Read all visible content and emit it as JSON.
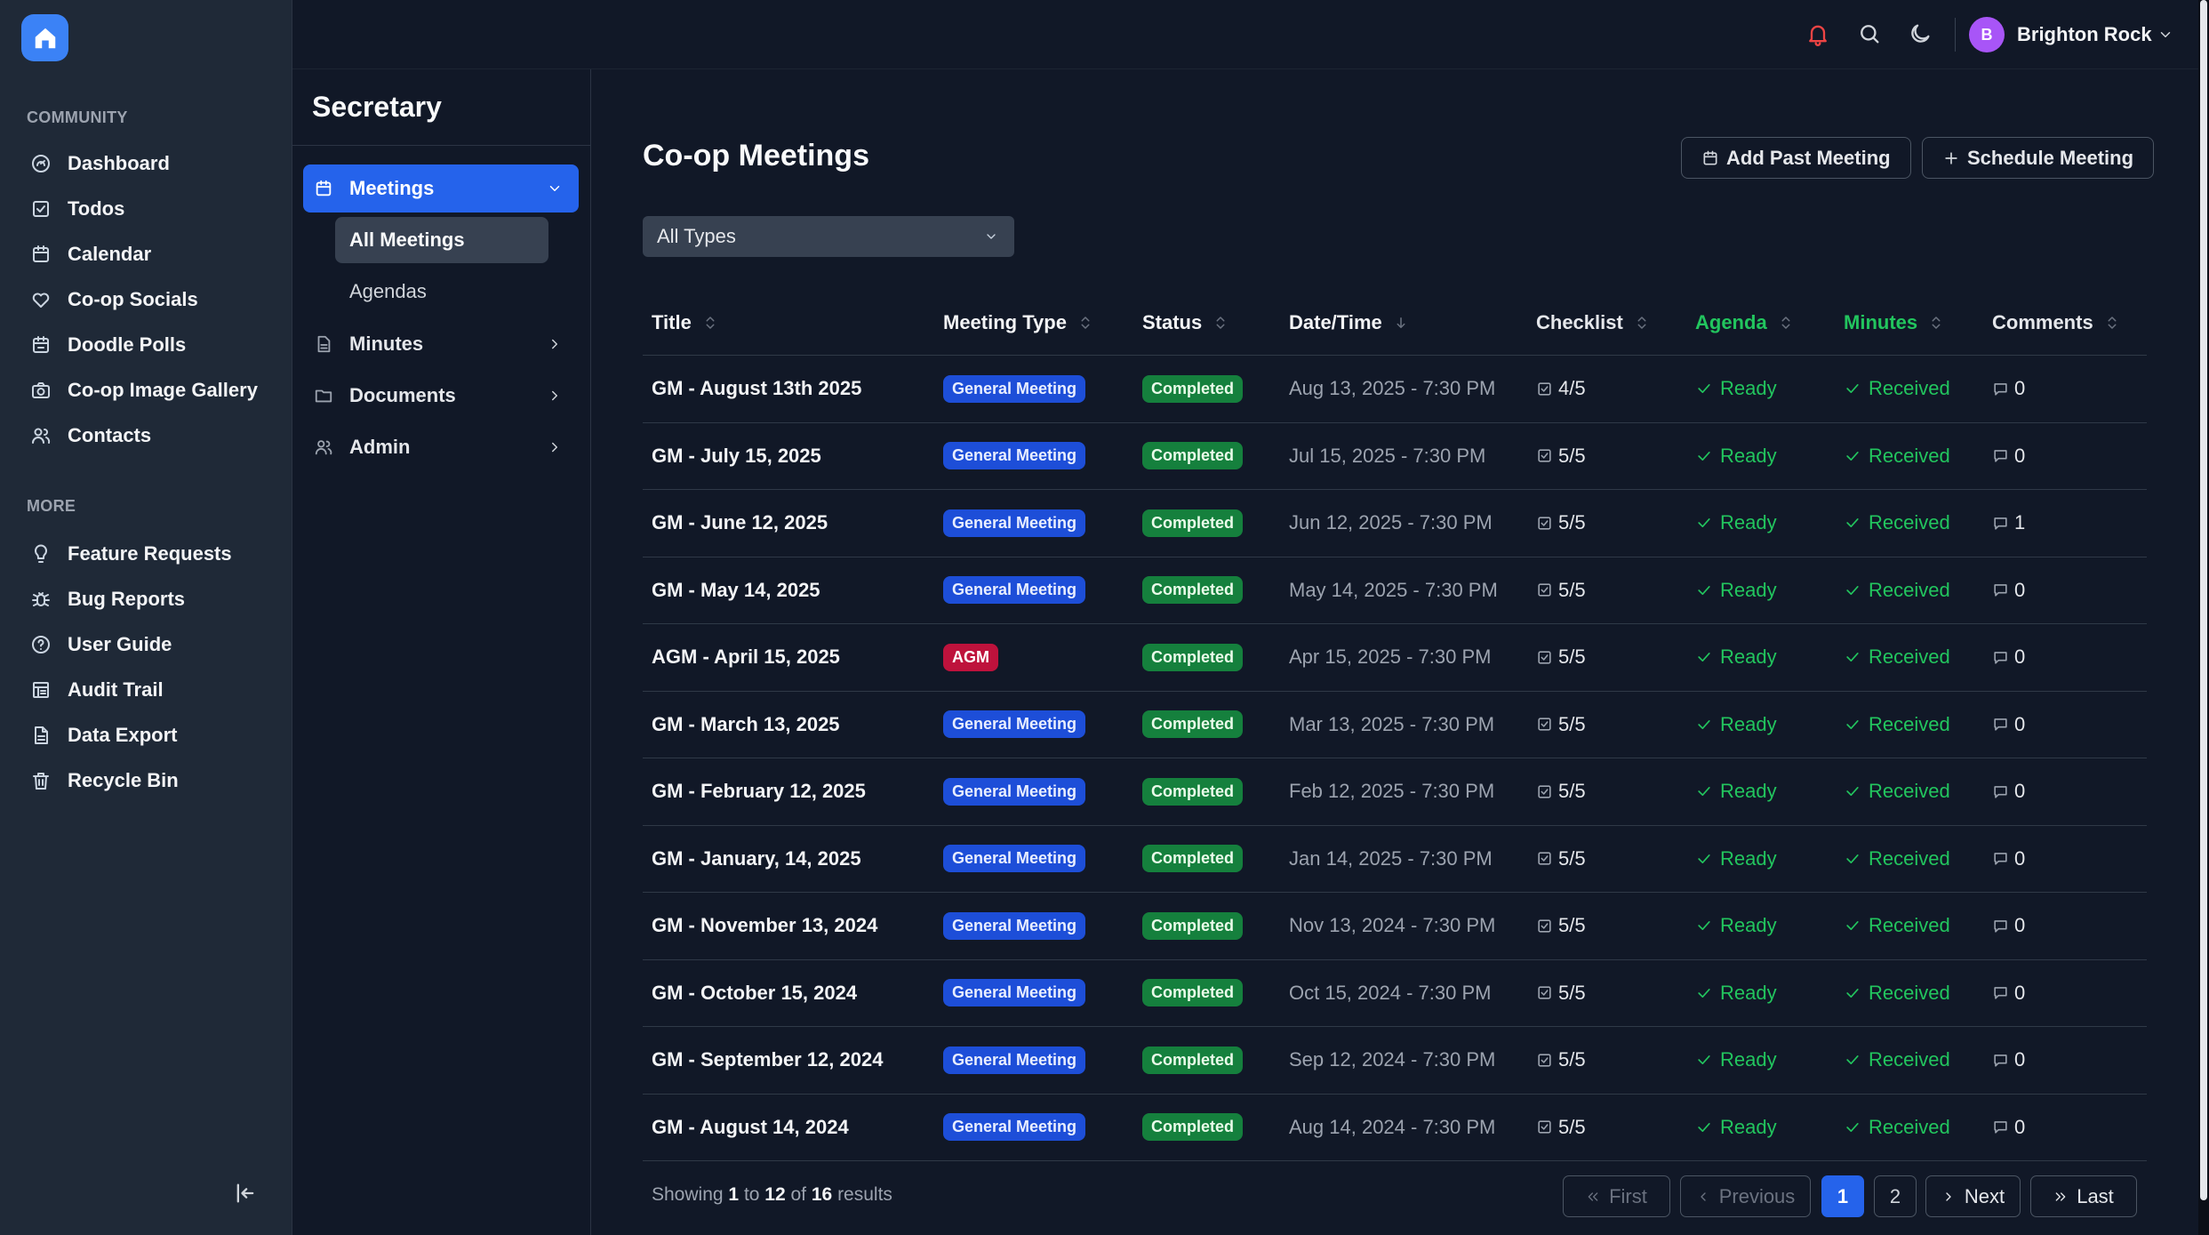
{
  "sidebar": {
    "community_heading": "COMMUNITY",
    "community_items": [
      {
        "label": "Dashboard",
        "icon": "dashboard-icon"
      },
      {
        "label": "Todos",
        "icon": "checkbox-icon"
      },
      {
        "label": "Calendar",
        "icon": "calendar-icon"
      },
      {
        "label": "Co-op Socials",
        "icon": "heart-icon"
      },
      {
        "label": "Doodle Polls",
        "icon": "calendar-check-icon"
      },
      {
        "label": "Co-op Image Gallery",
        "icon": "camera-icon"
      },
      {
        "label": "Contacts",
        "icon": "users-icon"
      }
    ],
    "more_heading": "MORE",
    "more_items": [
      {
        "label": "Feature Requests",
        "icon": "lightbulb-icon"
      },
      {
        "label": "Bug Reports",
        "icon": "bug-icon"
      },
      {
        "label": "User Guide",
        "icon": "help-circle-icon"
      },
      {
        "label": "Audit Trail",
        "icon": "audit-icon"
      },
      {
        "label": "Data Export",
        "icon": "file-icon"
      },
      {
        "label": "Recycle Bin",
        "icon": "trash-icon"
      }
    ]
  },
  "topbar": {
    "user_initial": "B",
    "user_name": "Brighton Rock"
  },
  "subnav": {
    "title": "Secretary",
    "meetings_label": "Meetings",
    "all_meetings_label": "All Meetings",
    "agendas_label": "Agendas",
    "minutes_label": "Minutes",
    "documents_label": "Documents",
    "admin_label": "Admin"
  },
  "main": {
    "title": "Co-op Meetings",
    "add_past_label": "Add Past Meeting",
    "schedule_label": "Schedule Meeting",
    "filter_value": "All Types",
    "columns": {
      "title": "Title",
      "type": "Meeting Type",
      "status": "Status",
      "date": "Date/Time",
      "checklist": "Checklist",
      "agenda": "Agenda",
      "minutes": "Minutes",
      "comments": "Comments"
    },
    "rows": [
      {
        "title": "GM - August 13th 2025",
        "type": "General Meeting",
        "status": "Completed",
        "date": "Aug 13, 2025 - 7:30 PM",
        "checklist": "4/5",
        "agenda": "Ready",
        "minutes": "Received",
        "comments": "0"
      },
      {
        "title": "GM - July 15, 2025",
        "type": "General Meeting",
        "status": "Completed",
        "date": "Jul 15, 2025 - 7:30 PM",
        "checklist": "5/5",
        "agenda": "Ready",
        "minutes": "Received",
        "comments": "0"
      },
      {
        "title": "GM - June 12, 2025",
        "type": "General Meeting",
        "status": "Completed",
        "date": "Jun 12, 2025 - 7:30 PM",
        "checklist": "5/5",
        "agenda": "Ready",
        "minutes": "Received",
        "comments": "1"
      },
      {
        "title": "GM - May 14, 2025",
        "type": "General Meeting",
        "status": "Completed",
        "date": "May 14, 2025 - 7:30 PM",
        "checklist": "5/5",
        "agenda": "Ready",
        "minutes": "Received",
        "comments": "0"
      },
      {
        "title": "AGM - April 15, 2025",
        "type": "AGM",
        "status": "Completed",
        "date": "Apr 15, 2025 - 7:30 PM",
        "checklist": "5/5",
        "agenda": "Ready",
        "minutes": "Received",
        "comments": "0"
      },
      {
        "title": "GM - March 13, 2025",
        "type": "General Meeting",
        "status": "Completed",
        "date": "Mar 13, 2025 - 7:30 PM",
        "checklist": "5/5",
        "agenda": "Ready",
        "minutes": "Received",
        "comments": "0"
      },
      {
        "title": "GM - February 12, 2025",
        "type": "General Meeting",
        "status": "Completed",
        "date": "Feb 12, 2025 - 7:30 PM",
        "checklist": "5/5",
        "agenda": "Ready",
        "minutes": "Received",
        "comments": "0"
      },
      {
        "title": "GM - January, 14, 2025",
        "type": "General Meeting",
        "status": "Completed",
        "date": "Jan 14, 2025 - 7:30 PM",
        "checklist": "5/5",
        "agenda": "Ready",
        "minutes": "Received",
        "comments": "0"
      },
      {
        "title": "GM - November 13, 2024",
        "type": "General Meeting",
        "status": "Completed",
        "date": "Nov 13, 2024 - 7:30 PM",
        "checklist": "5/5",
        "agenda": "Ready",
        "minutes": "Received",
        "comments": "0"
      },
      {
        "title": "GM - October 15, 2024",
        "type": "General Meeting",
        "status": "Completed",
        "date": "Oct 15, 2024 - 7:30 PM",
        "checklist": "5/5",
        "agenda": "Ready",
        "minutes": "Received",
        "comments": "0"
      },
      {
        "title": "GM - September 12, 2024",
        "type": "General Meeting",
        "status": "Completed",
        "date": "Sep 12, 2024 - 7:30 PM",
        "checklist": "5/5",
        "agenda": "Ready",
        "minutes": "Received",
        "comments": "0"
      },
      {
        "title": "GM - August 14, 2024",
        "type": "General Meeting",
        "status": "Completed",
        "date": "Aug 14, 2024 - 7:30 PM",
        "checklist": "5/5",
        "agenda": "Ready",
        "minutes": "Received",
        "comments": "0"
      }
    ]
  },
  "pagination": {
    "showing_prefix": "Showing",
    "from": "1",
    "to_word": "to",
    "to": "12",
    "of_word": "of",
    "total": "16",
    "results_word": "results",
    "first_label": "First",
    "previous_label": "Previous",
    "pages": [
      "1",
      "2"
    ],
    "next_label": "Next",
    "last_label": "Last"
  },
  "colors": {
    "accent": "#2563eb",
    "agm": "#be123c",
    "completed": "#15803d",
    "ready": "#22c55e",
    "bell": "#ef4444",
    "avatar": "#a855f7"
  }
}
